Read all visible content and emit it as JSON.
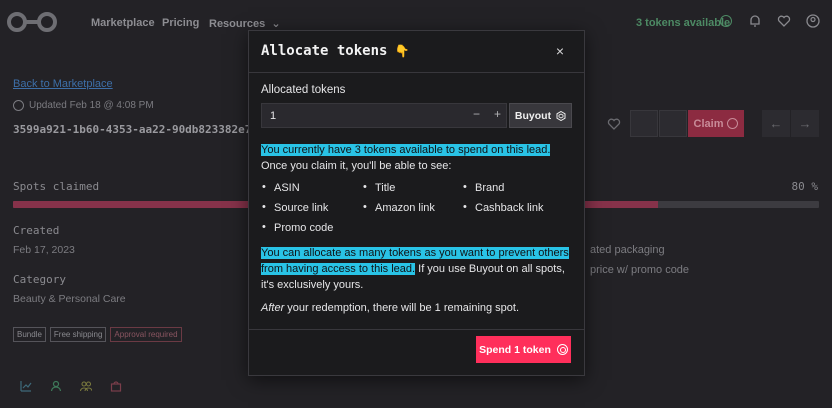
{
  "nav": {
    "links": [
      "Marketplace",
      "Pricing",
      "Resources"
    ],
    "tokens_available": "3 tokens available"
  },
  "page": {
    "back_link": "Back to Marketplace",
    "updated": "Updated Feb 18 @ 4:08 PM",
    "uuid": "3599a921-1b60-4353-aa22-90db823382e7",
    "claim_label": "Claim",
    "spots_label": "Spots claimed",
    "spots_pct_text": "80 %",
    "spots_fraction": 0.8,
    "created_label": "Created",
    "created_value": "Feb 17, 2023",
    "category_label": "Category",
    "category_value": "Beauty & Personal Care",
    "side_text_1": "ated packaging",
    "side_text_2": "price w/ promo code",
    "tags": [
      "Bundle",
      "Free shipping",
      "Approval required"
    ],
    "colors": {
      "progress": "#86324a",
      "claim": "#8c2b41",
      "tokens": "#4d8a64"
    }
  },
  "modal": {
    "title": "Allocate tokens",
    "title_icon": "pointing-hand-icon",
    "close_label": "×",
    "alloc_label": "Allocated tokens",
    "alloc_value": "1",
    "minus_label": "−",
    "plus_label": "+",
    "buyout_label": "Buyout",
    "p1_highlight": "You currently have 3 tokens available to spend on this lead.",
    "p1_rest": "Once you claim it, you'll be able to see:",
    "bullets": [
      "ASIN",
      "Title",
      "Brand",
      "Source link",
      "Amazon link",
      "Cashback link",
      "Promo code"
    ],
    "p2_highlight": "You can allocate as many tokens as you want to prevent others from having access to this lead.",
    "p2_rest": " If you use Buyout on all spots, it's exclusively yours.",
    "p3_italic": "After",
    "p3_rest": " your redemption, there will be 1 remaining spot.",
    "spend_label": "Spend 1 token",
    "colors": {
      "highlight": "#29c3e6",
      "spend": "#ff2f5b"
    }
  }
}
